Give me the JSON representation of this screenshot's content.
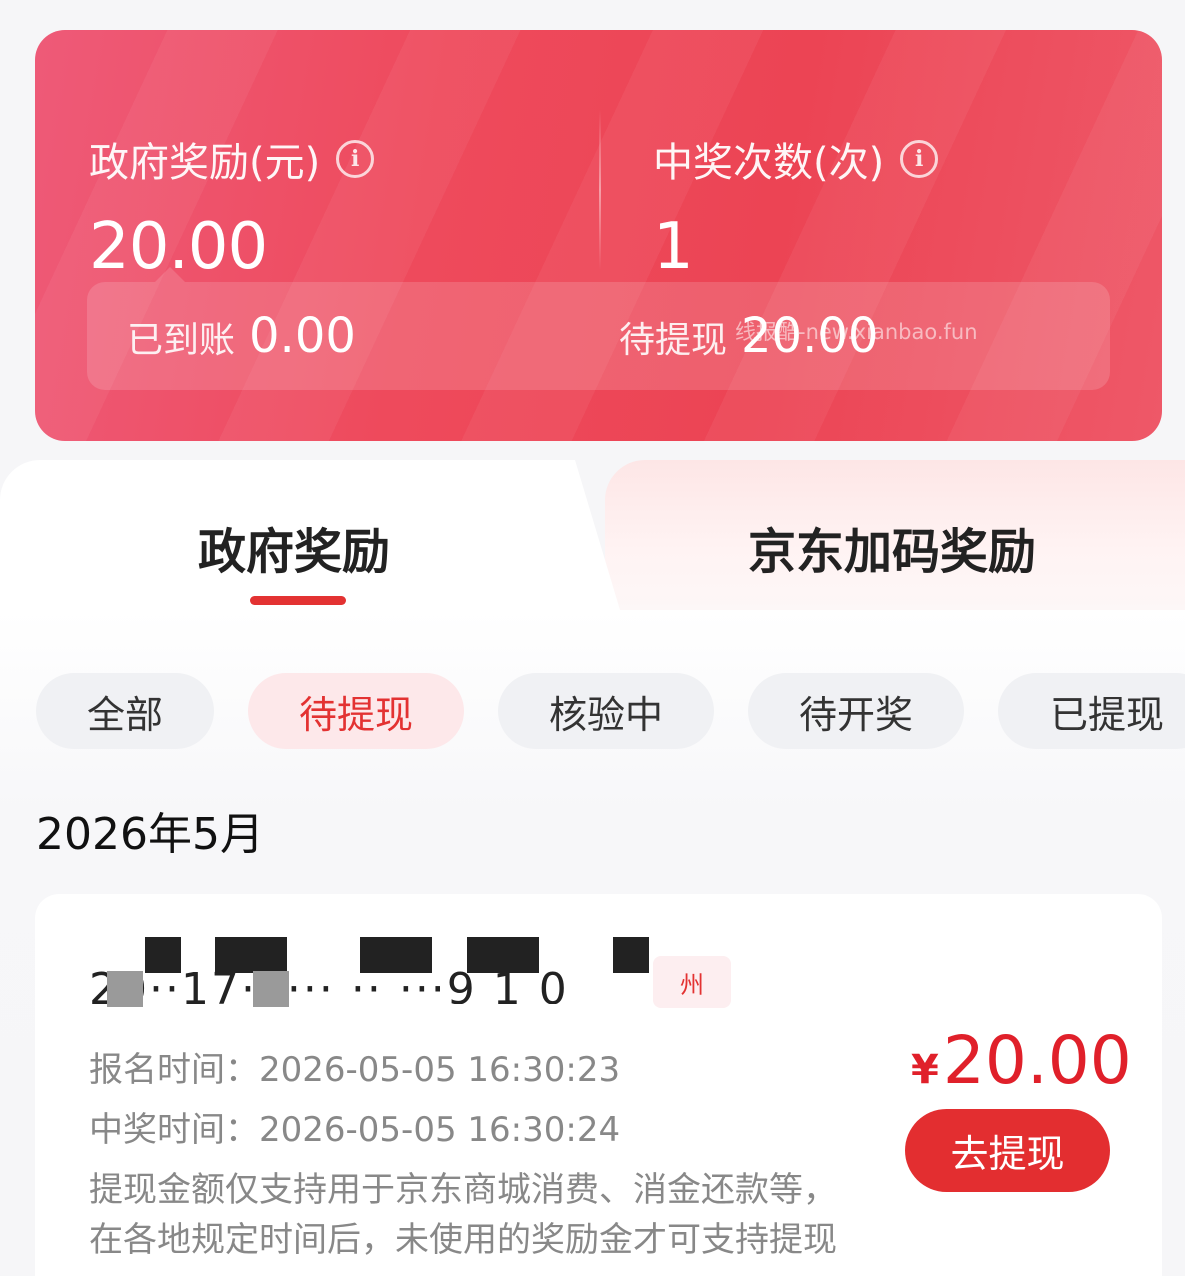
{
  "summary": {
    "gov_reward_label": "政府奖励(元)",
    "gov_reward_value": "20.00",
    "win_count_label": "中奖次数(次)",
    "win_count_value": "1",
    "received_label": "已到账",
    "received_value": "0.00",
    "pending_label": "待提现",
    "pending_value": "20.00",
    "watermark": "线报酷-new.xianbao.fun"
  },
  "tabs": [
    {
      "label": "政府奖励",
      "active": true
    },
    {
      "label": "京东加码奖励",
      "active": false
    }
  ],
  "filters": [
    {
      "label": "全部",
      "active": false
    },
    {
      "label": "待提现",
      "active": true
    },
    {
      "label": "核验中",
      "active": false
    },
    {
      "label": "待开奖",
      "active": false
    },
    {
      "label": "已提现",
      "active": false
    }
  ],
  "month_header": "2026年5月",
  "record": {
    "id_partial": "20··17·3··· ·· ···9 1 0",
    "city_tag": "州",
    "signup_label": "报名时间：",
    "signup_time": "2026-05-05 16:30:23",
    "win_label": "中奖时间：",
    "win_time": "2026-05-05 16:30:24",
    "note_line1": "提现金额仅支持用于京东商城消费、消金还款等，",
    "note_line2": "在各地规定时间后，未使用的奖励金才可支持提现",
    "currency": "¥",
    "amount": "20.00",
    "action_label": "去提现"
  },
  "colors": {
    "accent": "#e33232",
    "card_gradient_start": "#ee5a78",
    "card_gradient_end": "#ec4454"
  }
}
